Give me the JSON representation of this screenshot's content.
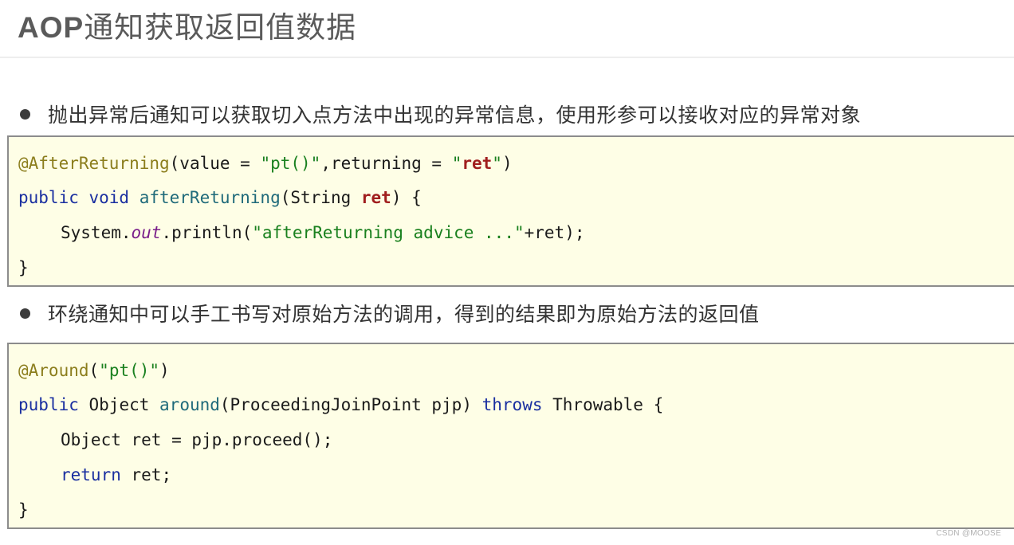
{
  "title": {
    "latin": "AOP",
    "chinese": "通知获取返回值数据"
  },
  "bullets": [
    {
      "text": "抛出异常后通知可以获取切入点方法中出现的异常信息，使用形参可以接收对应的异常对象"
    },
    {
      "text": "环绕通知中可以手工书写对原始方法的调用，得到的结果即为原始方法的返回值"
    }
  ],
  "code_blocks": [
    {
      "lines": [
        [
          {
            "t": "annotation",
            "v": "@AfterReturning"
          },
          {
            "t": "plain",
            "v": "(value = "
          },
          {
            "t": "string",
            "v": "\"pt()\""
          },
          {
            "t": "plain",
            "v": ",returning = "
          },
          {
            "t": "string",
            "v": "\""
          },
          {
            "t": "param",
            "v": "ret"
          },
          {
            "t": "string",
            "v": "\""
          },
          {
            "t": "plain",
            "v": ")"
          }
        ],
        [
          {
            "t": "keyword",
            "v": "public void "
          },
          {
            "t": "method",
            "v": "afterReturning"
          },
          {
            "t": "plain",
            "v": "(String "
          },
          {
            "t": "param",
            "v": "ret"
          },
          {
            "t": "plain",
            "v": ") {"
          }
        ],
        [
          {
            "t": "plain",
            "v": "System."
          },
          {
            "t": "static",
            "v": "out"
          },
          {
            "t": "plain",
            "v": ".println("
          },
          {
            "t": "string",
            "v": "\"afterReturning advice ...\""
          },
          {
            "t": "plain",
            "v": "+ret);"
          }
        ],
        [
          {
            "t": "plain",
            "v": "}"
          }
        ]
      ]
    },
    {
      "lines": [
        [
          {
            "t": "annotation",
            "v": "@Around"
          },
          {
            "t": "plain",
            "v": "("
          },
          {
            "t": "string",
            "v": "\"pt()\""
          },
          {
            "t": "plain",
            "v": ")"
          }
        ],
        [
          {
            "t": "keyword",
            "v": "public "
          },
          {
            "t": "plain",
            "v": "Object "
          },
          {
            "t": "method",
            "v": "around"
          },
          {
            "t": "plain",
            "v": "(ProceedingJoinPoint pjp) "
          },
          {
            "t": "keyword",
            "v": "throws "
          },
          {
            "t": "plain",
            "v": "Throwable {"
          }
        ],
        [
          {
            "t": "plain",
            "v": "Object ret = pjp.proceed();"
          }
        ],
        [
          {
            "t": "keyword",
            "v": "return "
          },
          {
            "t": "plain",
            "v": "ret;"
          }
        ],
        [
          {
            "t": "plain",
            "v": "}"
          }
        ]
      ]
    }
  ],
  "watermark": "CSDN @MOOSE"
}
